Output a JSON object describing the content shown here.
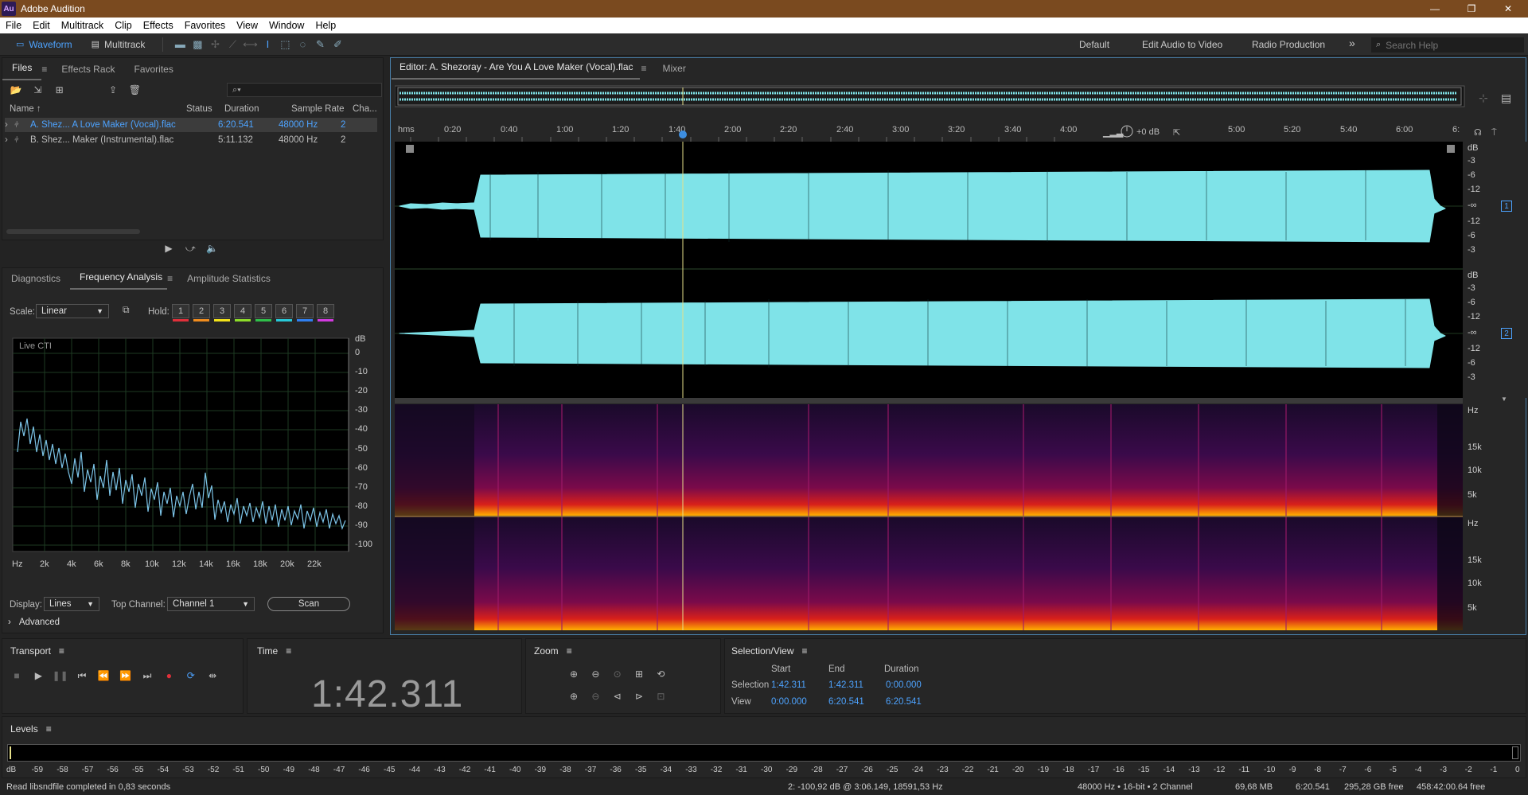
{
  "window": {
    "title": "Adobe Audition",
    "logo": "Au"
  },
  "menu": [
    "File",
    "Edit",
    "Multitrack",
    "Clip",
    "Effects",
    "Favorites",
    "View",
    "Window",
    "Help"
  ],
  "toolbar": {
    "waveform_label": "Waveform",
    "multitrack_label": "Multitrack",
    "workspaces": [
      "Default",
      "Edit Audio to Video",
      "Radio Production"
    ],
    "more": "»",
    "search_placeholder": "Search Help"
  },
  "files_panel": {
    "tabs": [
      "Files",
      "Effects Rack",
      "Favorites"
    ],
    "columns": {
      "name": "Name ↑",
      "status": "Status",
      "duration": "Duration",
      "sample_rate": "Sample Rate",
      "channels": "Cha..."
    },
    "rows": [
      {
        "name": "A. Shez... A Love Maker (Vocal).flac",
        "duration": "6:20.541",
        "sample_rate": "48000 Hz",
        "channels": "2",
        "selected": true
      },
      {
        "name": "B. Shez... Maker (Instrumental).flac",
        "duration": "5:11.132",
        "sample_rate": "48000 Hz",
        "channels": "2",
        "selected": false
      }
    ]
  },
  "analysis_panel": {
    "tabs": [
      "Diagnostics",
      "Frequency Analysis",
      "Amplitude Statistics"
    ],
    "scale_label": "Scale:",
    "scale_value": "Linear",
    "hold_label": "Hold:",
    "hold": [
      {
        "n": "1",
        "color": "#e0303a"
      },
      {
        "n": "2",
        "color": "#f08c1e"
      },
      {
        "n": "3",
        "color": "#f2e21a"
      },
      {
        "n": "4",
        "color": "#8ddc2a"
      },
      {
        "n": "5",
        "color": "#2fbf4a"
      },
      {
        "n": "6",
        "color": "#28c8d8"
      },
      {
        "n": "7",
        "color": "#2f7ff0"
      },
      {
        "n": "8",
        "color": "#d23adf"
      }
    ],
    "graph_label": "Live CTI",
    "db_unit": "dB",
    "db_ticks": [
      "0",
      "-10",
      "-20",
      "-30",
      "-40",
      "-50",
      "-60",
      "-70",
      "-80",
      "-90",
      "-100"
    ],
    "hz_ticks": [
      "Hz",
      "2k",
      "4k",
      "6k",
      "8k",
      "10k",
      "12k",
      "14k",
      "16k",
      "18k",
      "20k",
      "22k"
    ],
    "display_label": "Display:",
    "display_value": "Lines",
    "top_channel_label": "Top Channel:",
    "top_channel_value": "Channel 1",
    "scan_label": "Scan",
    "advanced_label": "Advanced"
  },
  "editor": {
    "tab_label": "Editor: A. Shezoray - Are You A Love Maker (Vocal).flac",
    "mixer_label": "Mixer",
    "time_ticks": [
      "hms",
      "0:20",
      "0:40",
      "1:00",
      "1:20",
      "1:40",
      "2:00",
      "2:20",
      "2:40",
      "3:00",
      "3:20",
      "3:40",
      "4:00",
      "5:00",
      "5:20",
      "5:40",
      "6:00",
      "6:"
    ],
    "volume": "+0 dB",
    "db_scale": [
      "dB",
      "-3",
      "-6",
      "-12",
      "-∞",
      "-12",
      "-6",
      "-3"
    ],
    "channels": [
      "1",
      "2"
    ],
    "hz_scale": [
      "Hz",
      "15k",
      "10k",
      "5k"
    ],
    "waveform_color": "#7fe3e8",
    "playhead_color": "#e6e08a"
  },
  "transport": {
    "title": "Transport"
  },
  "time_panel": {
    "title": "Time",
    "value": "1:42.311"
  },
  "zoom_panel": {
    "title": "Zoom"
  },
  "selection_view": {
    "title": "Selection/View",
    "headers": [
      "Start",
      "End",
      "Duration"
    ],
    "selection": {
      "label": "Selection",
      "start": "1:42.311",
      "end": "1:42.311",
      "duration": "0:00.000"
    },
    "view": {
      "label": "View",
      "start": "0:00.000",
      "end": "6:20.541",
      "duration": "6:20.541"
    }
  },
  "levels": {
    "title": "Levels",
    "ticks": [
      "dB",
      "-59",
      "-58",
      "-57",
      "-56",
      "-55",
      "-54",
      "-53",
      "-52",
      "-51",
      "-50",
      "-49",
      "-48",
      "-47",
      "-46",
      "-45",
      "-44",
      "-43",
      "-42",
      "-41",
      "-40",
      "-39",
      "-38",
      "-37",
      "-36",
      "-35",
      "-34",
      "-33",
      "-32",
      "-31",
      "-30",
      "-29",
      "-28",
      "-27",
      "-26",
      "-25",
      "-24",
      "-23",
      "-22",
      "-21",
      "-20",
      "-19",
      "-18",
      "-17",
      "-16",
      "-15",
      "-14",
      "-13",
      "-12",
      "-11",
      "-10",
      "-9",
      "-8",
      "-7",
      "-6",
      "-5",
      "-4",
      "-3",
      "-2",
      "-1",
      "0"
    ]
  },
  "status": {
    "left": "Read libsndfile completed in 0,83 seconds",
    "cursor": "2: -100,92 dB @ 3:06.149, 18591,53 Hz",
    "format": "48000 Hz • 16-bit • 2 Channel",
    "size": "69,68 MB",
    "duration": "6:20.541",
    "free": "295,28 GB free",
    "free_time": "458:42:00.64 free"
  }
}
